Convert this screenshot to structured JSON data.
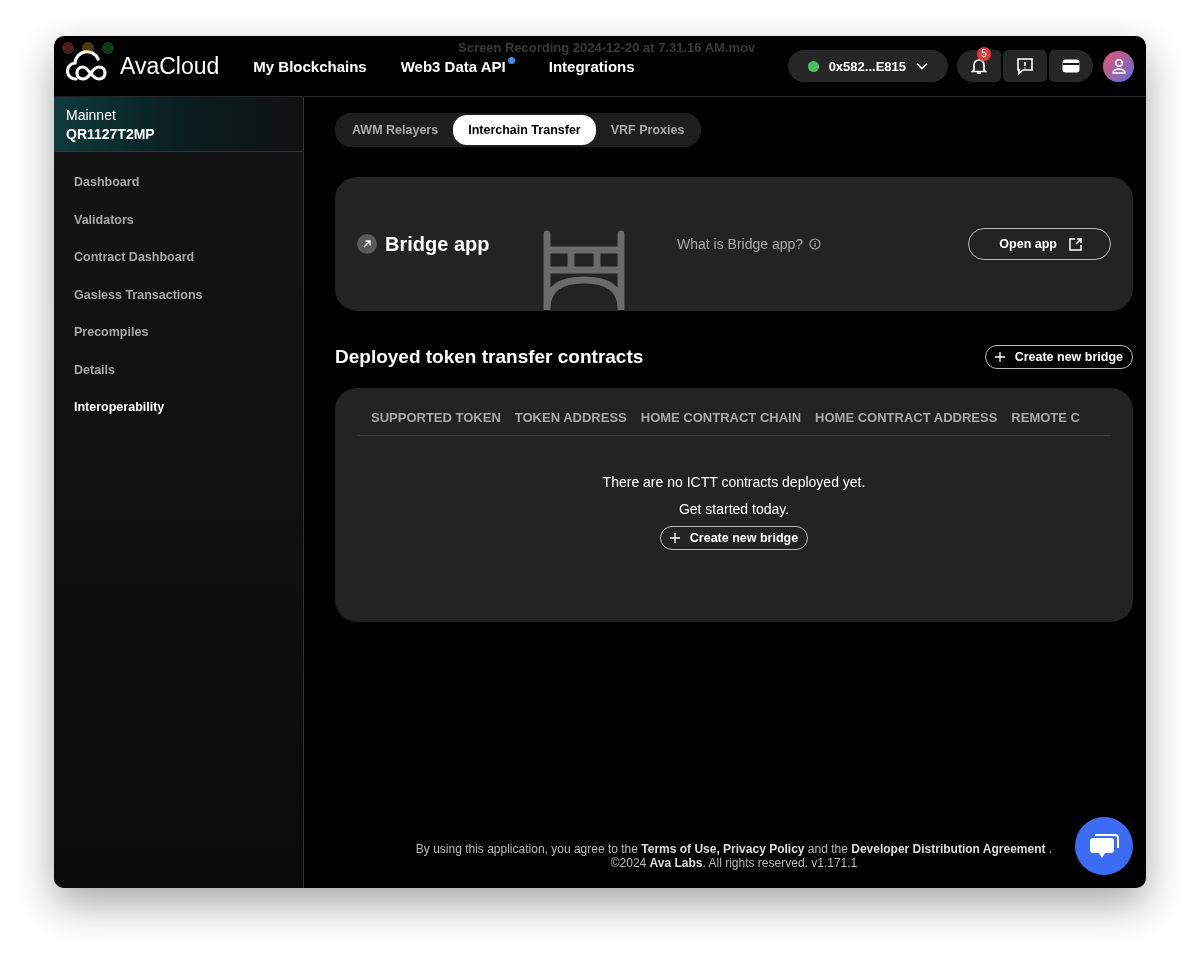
{
  "window": {
    "title": "Screen Recording 2024-12-20 at 7.31.16 AM.mov"
  },
  "header": {
    "logo": "AvaCloud",
    "nav": [
      {
        "label": "My Blockchains",
        "badge": false
      },
      {
        "label": "Web3 Data API",
        "badge": true
      },
      {
        "label": "Integrations",
        "badge": false
      }
    ],
    "wallet": {
      "address": "0x582...E815",
      "connected": true
    },
    "notifications": {
      "count": "5"
    }
  },
  "sidebar": {
    "network": "Mainnet",
    "chain_id": "QR1127T2MP",
    "items": [
      {
        "label": "Dashboard",
        "selected": false
      },
      {
        "label": "Validators",
        "selected": false
      },
      {
        "label": "Contract Dashboard",
        "selected": false
      },
      {
        "label": "Gasless Transactions",
        "selected": false
      },
      {
        "label": "Precompiles",
        "selected": false
      },
      {
        "label": "Details",
        "selected": false
      },
      {
        "label": "Interoperability",
        "selected": true
      }
    ]
  },
  "tabs": [
    {
      "label": "AWM Relayers",
      "selected": false
    },
    {
      "label": "Interchain Transfer",
      "selected": true
    },
    {
      "label": "VRF Proxies",
      "selected": false
    }
  ],
  "bridge_card": {
    "title": "Bridge app",
    "help": "What is Bridge app?",
    "button": "Open app"
  },
  "contracts": {
    "title": "Deployed token transfer contracts",
    "create_button": "Create new bridge",
    "columns": [
      "SUPPORTED TOKEN",
      "TOKEN ADDRESS",
      "HOME CONTRACT CHAIN",
      "HOME CONTRACT ADDRESS",
      "REMOTE C"
    ],
    "empty_message": "There are no ICTT contracts deployed yet.",
    "empty_hint": "Get started today.",
    "empty_button": "Create new bridge"
  },
  "footer": {
    "line1": [
      {
        "kind": "text",
        "text": "By using this application, you agree to the"
      },
      {
        "kind": "link",
        "text": "Terms of Use,"
      },
      {
        "kind": "link",
        "text": "Privacy Policy"
      },
      {
        "kind": "text",
        "text": "and the"
      },
      {
        "kind": "link",
        "text": "Developer Distribution Agreement"
      },
      {
        "kind": "text",
        "text": "."
      }
    ],
    "line2": "©2024 **Ava Labs**.  All rights reserved.  v1.171.1"
  }
}
